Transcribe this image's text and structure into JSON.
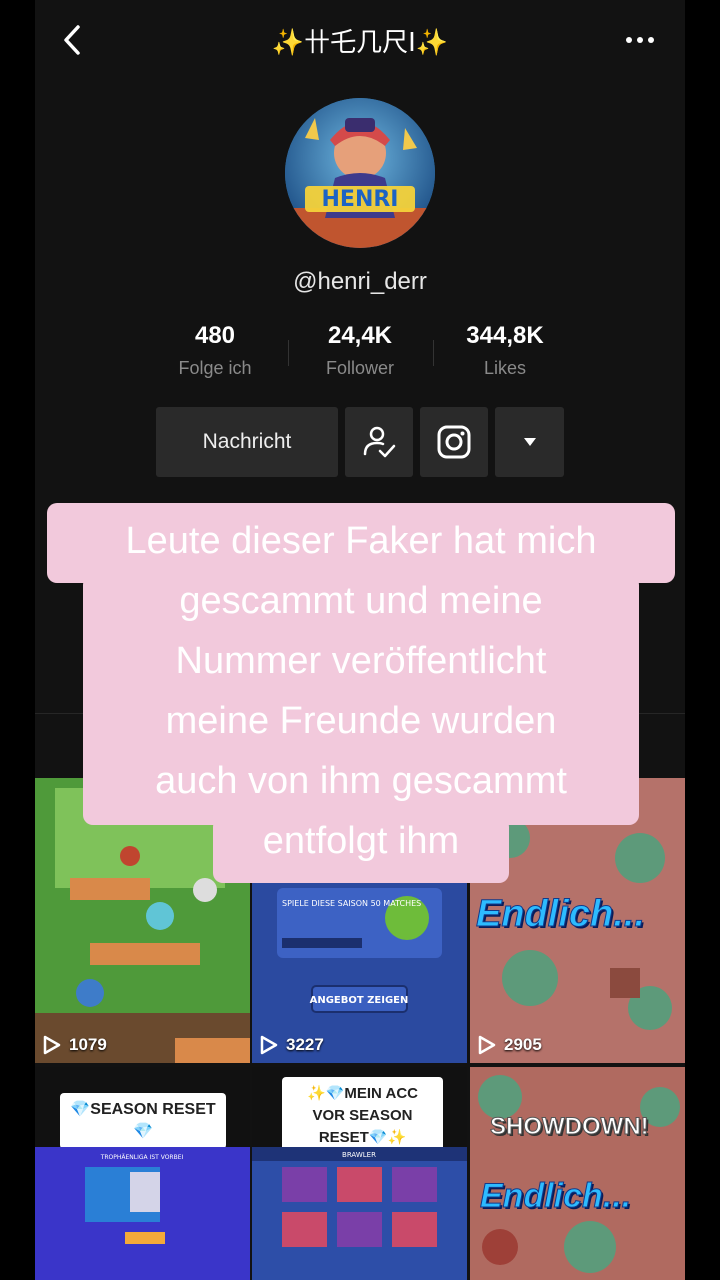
{
  "header": {
    "title": "✨卄乇几尺I✨"
  },
  "profile": {
    "handle": "@henri_derr",
    "avatar_text": "HENRI"
  },
  "stats": [
    {
      "value": "480",
      "label": "Folge ich"
    },
    {
      "value": "24,4K",
      "label": "Follower"
    },
    {
      "value": "344,8K",
      "label": "Likes"
    }
  ],
  "actions": {
    "message_label": "Nachricht"
  },
  "overlay": {
    "lines": [
      "Leute dieser Faker hat mich",
      "gescammt und meine",
      "Nummer veröffentlicht",
      "meine Freunde wurden",
      "auch von ihm gescammt",
      "entfolgt ihm"
    ]
  },
  "videos": [
    {
      "plays": "1079"
    },
    {
      "plays": "3227",
      "ingame_text": "SPIELE DIESE SAISON 50 MATCHES",
      "button_text": "ANGEBOT ZEIGEN"
    },
    {
      "plays": "2905",
      "game_title": "Endlich..."
    },
    {
      "caption": "💎SEASON RESET💎",
      "ingame_text": "TROPHÄENLIGA IST VORBEI"
    },
    {
      "caption": "✨💎MEIN ACC VOR SEASON RESET💎✨",
      "ingame_text": "BRAWLER"
    },
    {
      "game_title": "SHOWDOWN!",
      "game_title_2": "Endlich..."
    }
  ],
  "colors": {
    "background": "#121212",
    "overlay": "#f2c9dc",
    "button": "#2a2a2a",
    "secondary_text": "#8a8a8a"
  },
  "icons": [
    "chevron-left-icon",
    "more-dots-icon",
    "follow-check-icon",
    "instagram-icon",
    "caret-down-icon",
    "play-icon"
  ]
}
